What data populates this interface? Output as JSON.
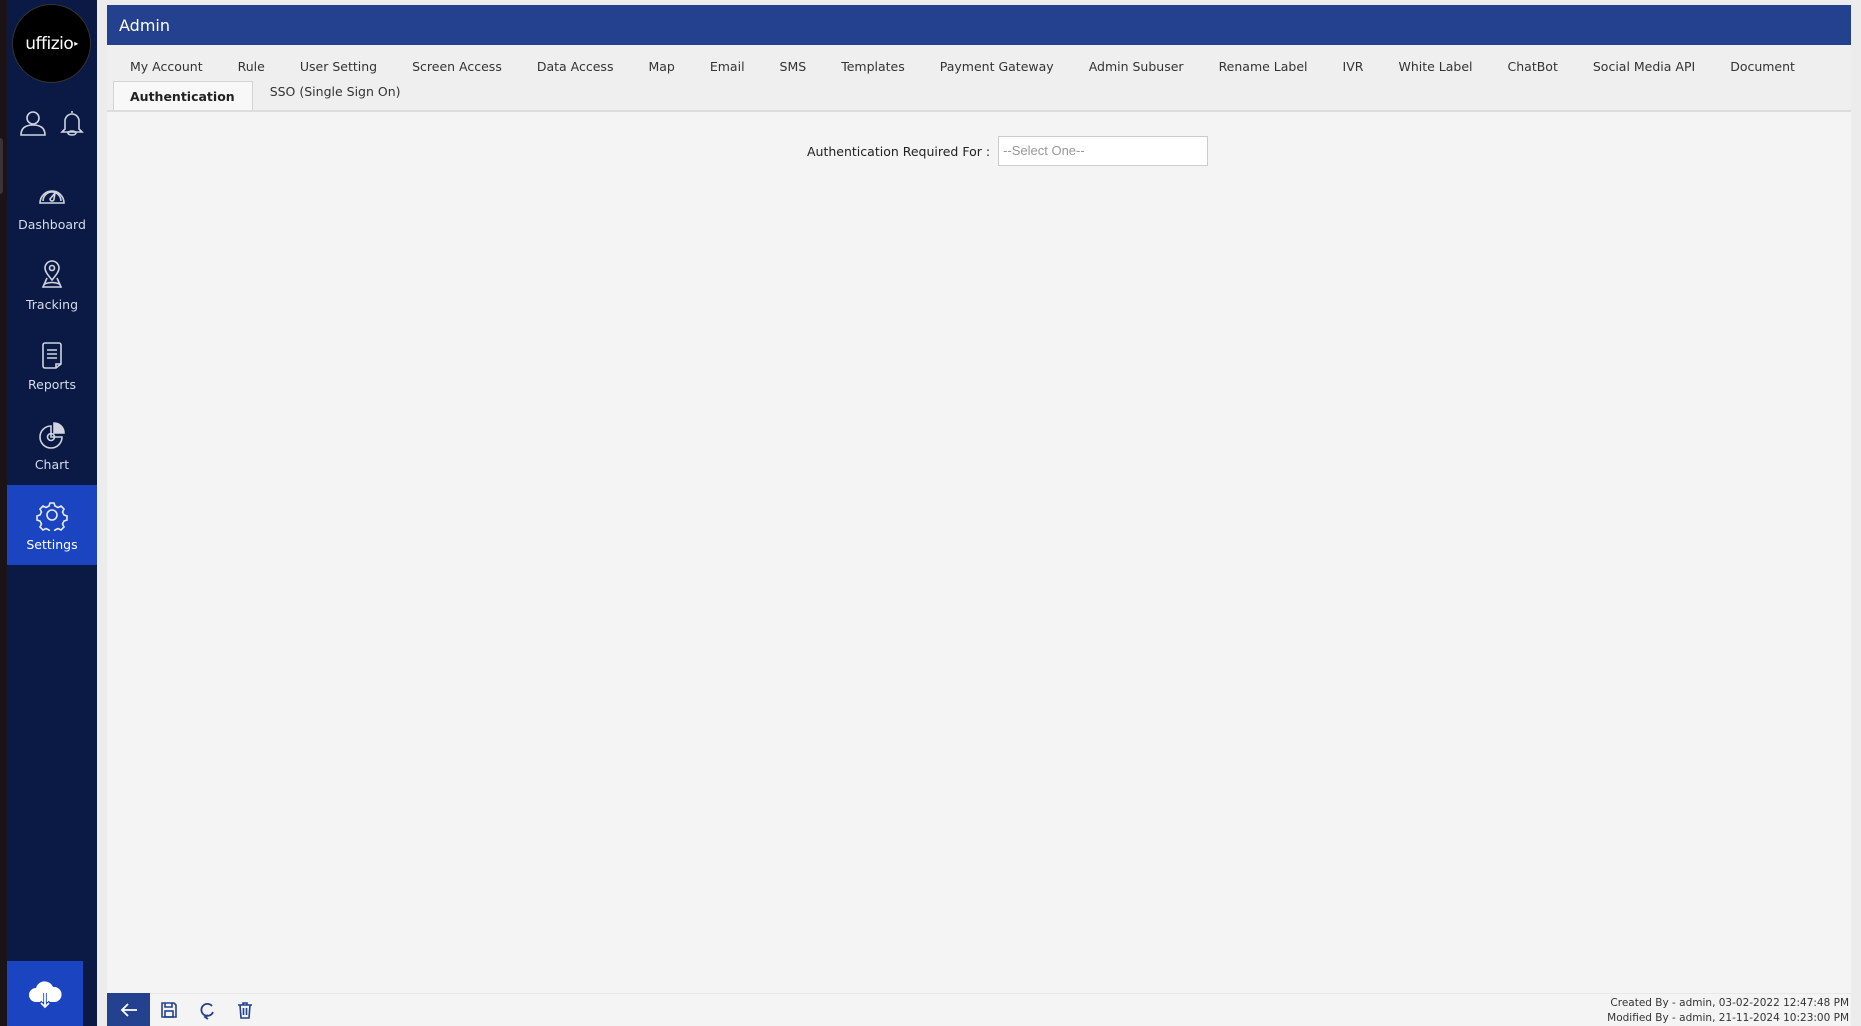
{
  "brand": {
    "logo_text": "uffizio",
    "logo_suffix": "▸"
  },
  "sidebar": {
    "top_icons": [
      {
        "name": "user-profile-icon"
      },
      {
        "name": "notifications-bell-icon"
      }
    ],
    "items": [
      {
        "label": "Dashboard",
        "icon": "dashboard-gauge-icon"
      },
      {
        "label": "Tracking",
        "icon": "tracking-pin-icon"
      },
      {
        "label": "Reports",
        "icon": "reports-document-icon"
      },
      {
        "label": "Chart",
        "icon": "chart-pie-icon"
      },
      {
        "label": "Settings",
        "icon": "settings-gear-icon",
        "active": true
      }
    ],
    "bottom_button": {
      "icon": "cloud-download-icon"
    }
  },
  "header": {
    "title": "Admin"
  },
  "tabs": [
    {
      "label": "My Account"
    },
    {
      "label": "Rule"
    },
    {
      "label": "User Setting"
    },
    {
      "label": "Screen Access"
    },
    {
      "label": "Data Access"
    },
    {
      "label": "Map"
    },
    {
      "label": "Email"
    },
    {
      "label": "SMS"
    },
    {
      "label": "Templates"
    },
    {
      "label": "Payment Gateway"
    },
    {
      "label": "Admin Subuser"
    },
    {
      "label": "Rename Label"
    },
    {
      "label": "IVR"
    },
    {
      "label": "White Label"
    },
    {
      "label": "ChatBot"
    },
    {
      "label": "Social Media API"
    },
    {
      "label": "Document"
    },
    {
      "label": "Authentication",
      "active": true
    },
    {
      "label": "SSO (Single Sign On)"
    }
  ],
  "form": {
    "auth_required_label": "Authentication Required For :",
    "auth_required_value": "--Select One--"
  },
  "footer": {
    "buttons": [
      "back",
      "save",
      "refresh",
      "delete"
    ],
    "created_by": "Created By - admin, 03-02-2022 12:47:48 PM",
    "modified_by": "Modified By - admin, 21-11-2024 10:23:00 PM"
  },
  "colors": {
    "sidebar_bg": "#0a1a45",
    "active_nav": "#1a44c0",
    "header_bg": "#23418f",
    "content_bg": "#f4f4f4"
  }
}
